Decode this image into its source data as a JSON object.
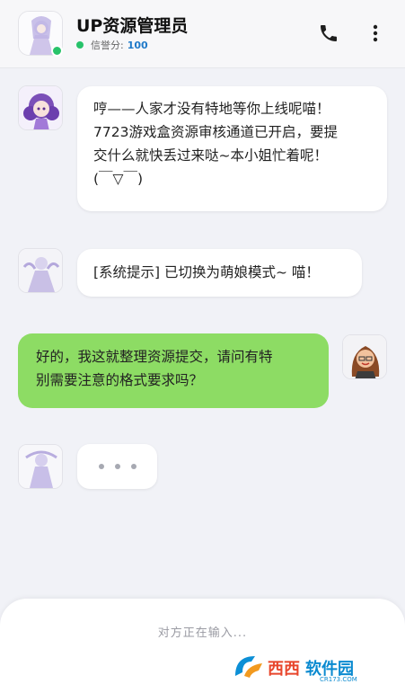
{
  "header": {
    "title": "UP资源管理员",
    "credit_label": "信誉分:",
    "credit_value": "100",
    "icons": {
      "call": "phone-icon",
      "more": "more-vertical-icon"
    }
  },
  "messages": [
    {
      "sender": "bot",
      "text": "哼——人家才没有特地等你上线呢喵！\n7723游戏盒资源审核通道已开启，要提\n交什么就快丢过来哒~本小姐忙着呢！\n(￣▽￣)"
    },
    {
      "sender": "system",
      "text": "[系统提示] 已切换为萌娘模式~ 喵！"
    },
    {
      "sender": "user",
      "text": "好的，我这就整理资源提交，请问有特\n别需要注意的格式要求吗？"
    }
  ],
  "typing_status": "对方正在输入...",
  "watermark": {
    "brand": "西西软件园",
    "domain": "CR173.COM"
  },
  "colors": {
    "user_bubble": "#8ddc64",
    "online": "#28c36a",
    "credit": "#1f7ac9"
  }
}
